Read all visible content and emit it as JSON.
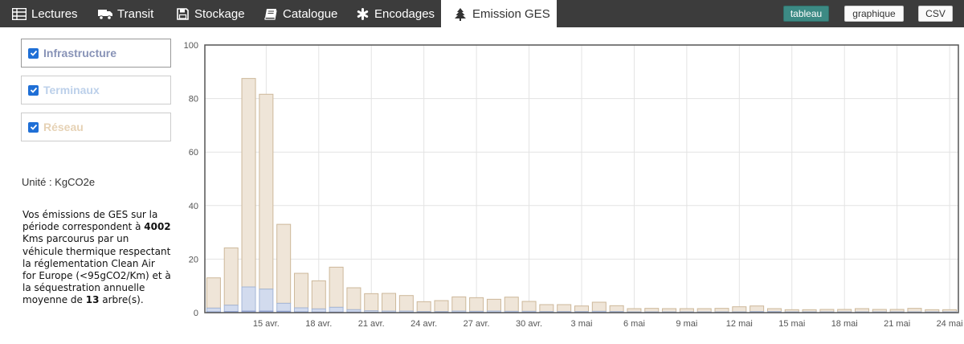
{
  "tabs": [
    {
      "label": "Lectures",
      "icon": "table-icon",
      "active": false
    },
    {
      "label": "Transit",
      "icon": "truck-icon",
      "active": false
    },
    {
      "label": "Stockage",
      "icon": "floppy-disk-icon",
      "active": false
    },
    {
      "label": "Catalogue",
      "icon": "book-icon",
      "active": false
    },
    {
      "label": "Encodages",
      "icon": "asterisk-icon",
      "active": false
    },
    {
      "label": "Emission GES",
      "icon": "tree-icon",
      "active": true
    }
  ],
  "toolbar": {
    "tableau": "tableau",
    "graphique": "graphique",
    "csv": "CSV"
  },
  "filters": [
    {
      "label": "Infrastructure",
      "checked": true,
      "color": "#6a7fc0"
    },
    {
      "label": "Terminaux",
      "checked": true,
      "color": "#b7c8e6"
    },
    {
      "label": "Réseau",
      "checked": true,
      "color": "#e0c9a8"
    }
  ],
  "unit": "Unité : KgCO2e",
  "info": {
    "p1": "Vos émissions de GES sur la période correspondent à ",
    "kms": "4002",
    "p2": " Kms parcourus par un véhicule thermique respectant la réglementation Clean Air for Europe (<95gCO2/Km) et à la séquestration annuelle moyenne de ",
    "trees": "13",
    "p3": " arbre(s)."
  },
  "chart_data": {
    "type": "bar",
    "stacked": true,
    "ylim": [
      0,
      100
    ],
    "yticks": [
      0,
      20,
      40,
      60,
      80,
      100
    ],
    "grid": true,
    "xtick_labels": [
      "15 avr.",
      "18 avr.",
      "21 avr.",
      "24 avr.",
      "27 avr.",
      "30 avr.",
      "3 mai",
      "6 mai",
      "9 mai",
      "12 mai",
      "15 mai",
      "18 mai",
      "21 mai",
      "24 mai"
    ],
    "categories": [
      "12 avr.",
      "13 avr.",
      "14 avr.",
      "15 avr.",
      "16 avr.",
      "17 avr.",
      "18 avr.",
      "19 avr.",
      "20 avr.",
      "21 avr.",
      "22 avr.",
      "23 avr.",
      "24 avr.",
      "25 avr.",
      "26 avr.",
      "27 avr.",
      "28 avr.",
      "29 avr.",
      "30 avr.",
      "1 mai",
      "2 mai",
      "3 mai",
      "4 mai",
      "5 mai",
      "6 mai",
      "7 mai",
      "8 mai",
      "9 mai",
      "10 mai",
      "11 mai",
      "12 mai",
      "13 mai",
      "14 mai",
      "15 mai",
      "16 mai",
      "17 mai",
      "18 mai",
      "19 mai",
      "20 mai",
      "21 mai",
      "22 mai",
      "23 mai",
      "24 mai"
    ],
    "series": [
      {
        "name": "Infrastructure",
        "color": "#6a7fc0",
        "values": [
          0.3,
          0.4,
          0.6,
          0.6,
          0.5,
          0.3,
          0.2,
          0.2,
          0.2,
          0.1,
          0.1,
          0.1,
          0.1,
          0.1,
          0.1,
          0.1,
          0.1,
          0.1,
          0.1,
          0.1,
          0.1,
          0.1,
          0.1,
          0.1,
          0.1,
          0.1,
          0.1,
          0.1,
          0.1,
          0.1,
          0.1,
          0.1,
          0.1,
          0.1,
          0.1,
          0.1,
          0.1,
          0.1,
          0.1,
          0.1,
          0.1,
          0.1,
          0.1
        ]
      },
      {
        "name": "Terminaux",
        "color": "#b7c8e6",
        "values": [
          1.4,
          2.4,
          9.0,
          8.2,
          3.0,
          1.5,
          1.2,
          1.8,
          0.9,
          0.6,
          0.5,
          0.5,
          0.3,
          0.3,
          0.5,
          0.4,
          0.5,
          0.4,
          0.4,
          0.3,
          0.3,
          0.3,
          0.4,
          0.3,
          0.2,
          0.2,
          0.2,
          0.2,
          0.2,
          0.2,
          0.2,
          0.3,
          0.3,
          0.2,
          0.2,
          0.2,
          0.2,
          0.2,
          0.2,
          0.2,
          0.2,
          0.2,
          0.2
        ]
      },
      {
        "name": "Réseau",
        "color": "#e0c9a8",
        "values": [
          11.3,
          21.4,
          77.9,
          72.8,
          29.5,
          12.9,
          10.5,
          15.0,
          8.2,
          6.4,
          6.6,
          5.8,
          3.7,
          4.1,
          5.3,
          5.1,
          4.4,
          5.3,
          3.7,
          2.6,
          2.6,
          2.1,
          3.4,
          2.2,
          1.2,
          1.3,
          1.2,
          1.2,
          1.2,
          1.3,
          1.9,
          2.1,
          1.1,
          0.8,
          0.8,
          0.9,
          0.9,
          1.2,
          0.9,
          0.9,
          1.3,
          0.8,
          0.8
        ]
      }
    ]
  }
}
